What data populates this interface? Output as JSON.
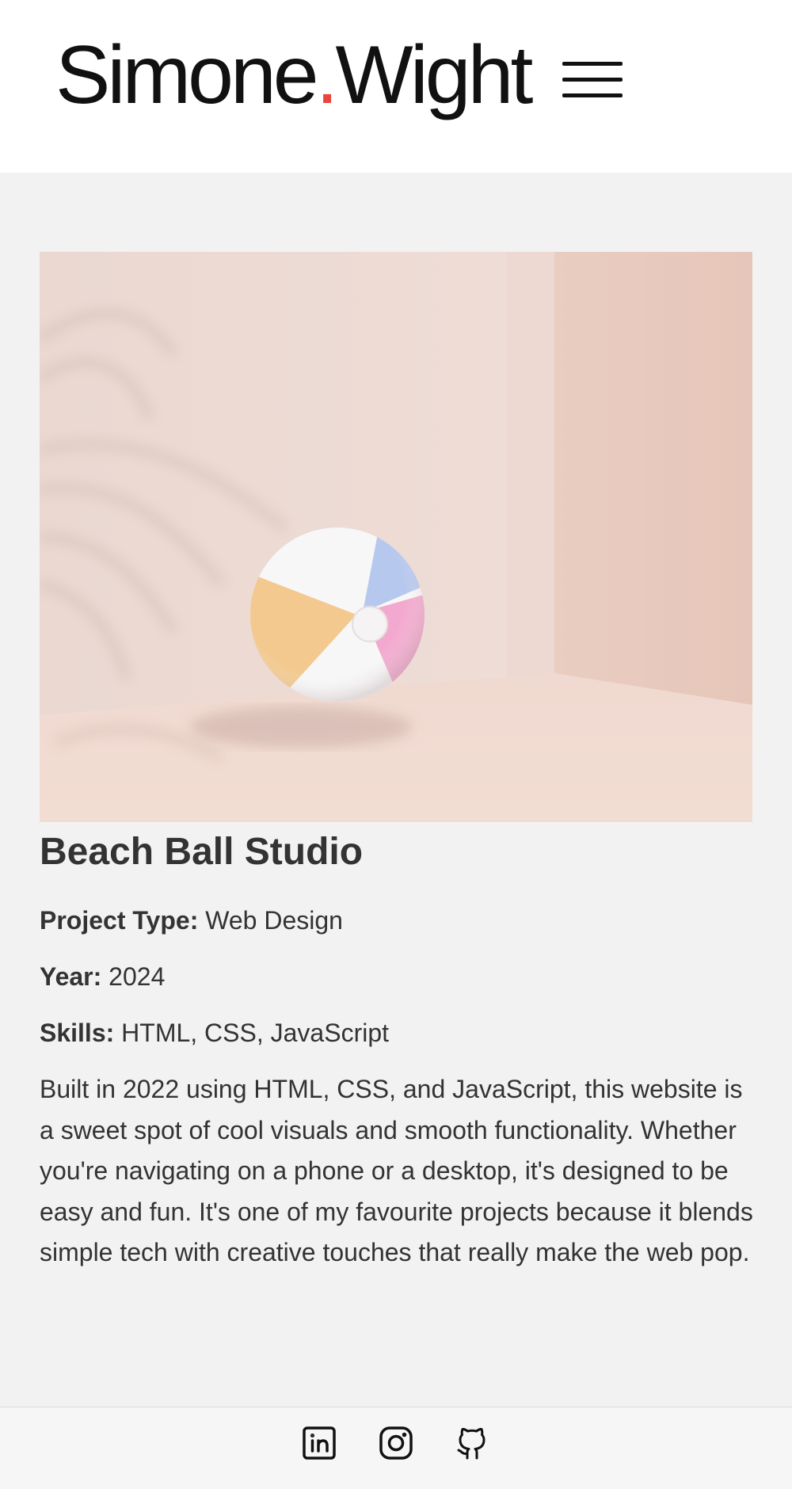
{
  "header": {
    "logo_first": "Simone",
    "logo_dot": ".",
    "logo_last": "Wight",
    "menu_icon": "hamburger-menu-icon"
  },
  "project": {
    "image_alt": "Beach ball in a pink studio",
    "title": "Beach Ball Studio",
    "type_label": "Project Type:",
    "type_value": "Web Design",
    "year_label": "Year:",
    "year_value": "2024",
    "skills_label": "Skills:",
    "skills_value": "HTML, CSS, JavaScript",
    "description": "Built in 2022 using HTML, CSS, and JavaScript, this website is a sweet spot of cool visuals and smooth functionality. Whether you're navigating on a phone or a desktop, it's designed to be easy and fun. It's one of my favourite projects because it blends simple tech with creative touches that really make the web pop."
  },
  "footer": {
    "links": [
      {
        "icon": "linkedin-icon"
      },
      {
        "icon": "instagram-icon"
      },
      {
        "icon": "github-icon"
      }
    ]
  },
  "colors": {
    "accent": "#e8463a",
    "text": "#333333",
    "background": "#f3f2f2"
  }
}
